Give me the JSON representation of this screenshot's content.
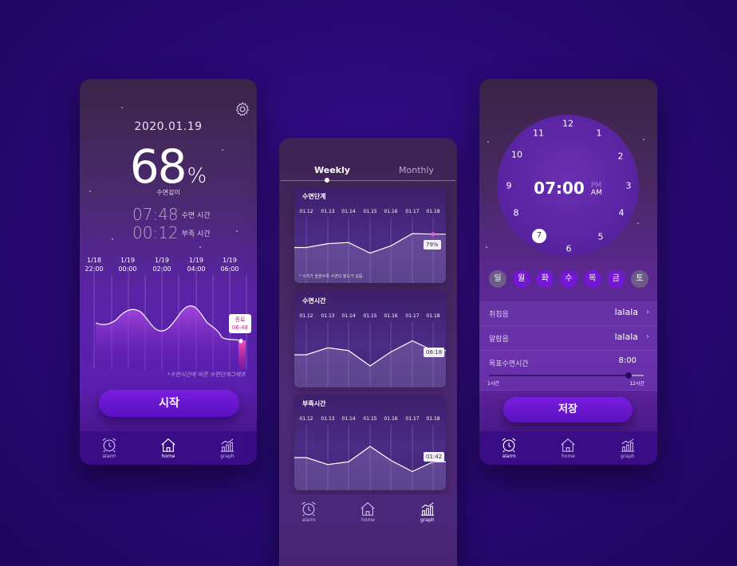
{
  "home": {
    "date": "2020.01.19",
    "percent": "68",
    "percent_unit": "%",
    "depth_label": "수면깊이",
    "sleep_time": "07:48",
    "sleep_time_label": "수면 시간",
    "short_time": "00:12",
    "short_time_label": "부족 시간",
    "timeline": [
      {
        "date": "1/18",
        "time": "22:00"
      },
      {
        "date": "1/19",
        "time": "00:00"
      },
      {
        "date": "1/19",
        "time": "02:00"
      },
      {
        "date": "1/19",
        "time": "04:00"
      },
      {
        "date": "1/19",
        "time": "06:00"
      }
    ],
    "end_tag_label": "종료",
    "end_tag_time": "06:48",
    "chart_note": "*수면시간에 따른 수면단계그래프",
    "start_button": "시작",
    "tabs": [
      {
        "label": "alarm"
      },
      {
        "label": "home"
      },
      {
        "label": "graph"
      }
    ]
  },
  "graph": {
    "segment_weekly": "Weekly",
    "segment_monthly": "Monthly",
    "dates": [
      "01.12",
      "01.13",
      "01.14",
      "01.15",
      "01.16",
      "01.17",
      "01.18"
    ],
    "cards": [
      {
        "title": "수면단계",
        "tag": "79%",
        "note": "* 수치가 높을수록 수면의 질도가 깊음"
      },
      {
        "title": "수면시간",
        "tag": "06:18"
      },
      {
        "title": "부족시간",
        "tag": "01:42"
      }
    ],
    "tabs": [
      {
        "label": "alarm"
      },
      {
        "label": "home"
      },
      {
        "label": "graph"
      }
    ]
  },
  "alarm": {
    "clock_numbers": [
      "12",
      "1",
      "2",
      "3",
      "4",
      "5",
      "6",
      "7",
      "8",
      "9",
      "10",
      "11"
    ],
    "selected_hour": "7",
    "time": "07:00",
    "pm": "PM",
    "am": "AM",
    "days": [
      "일",
      "월",
      "화",
      "수",
      "목",
      "금",
      "토"
    ],
    "bedtime_label": "취침음",
    "bedtime_value": "lalala",
    "alarm_label": "알람음",
    "alarm_value": "lalala",
    "goal_label": "목표수면시간",
    "goal_value": "8:00",
    "slider_min": "1시간",
    "slider_max": "12시간",
    "slider_fraction": 0.9,
    "save_button": "저장",
    "tabs": [
      {
        "label": "alarm"
      },
      {
        "label": "home"
      },
      {
        "label": "graph"
      }
    ]
  },
  "chart_data": [
    {
      "type": "area",
      "title": "",
      "x": [
        "01.12",
        "01.13",
        "01.14",
        "01.15",
        "01.16",
        "01.17",
        "01.18"
      ],
      "series": [
        {
          "values": [
            55,
            62,
            64,
            45,
            58,
            80,
            79
          ]
        }
      ],
      "ylim": [
        0,
        100
      ]
    },
    {
      "type": "line",
      "title": "",
      "x": [
        "01.12",
        "01.13",
        "01.14",
        "01.15",
        "01.16",
        "01.17",
        "01.18"
      ],
      "series": [
        {
          "values": [
            6.0,
            6.5,
            6.3,
            5.2,
            6.2,
            7.0,
            6.3
          ]
        }
      ]
    },
    {
      "type": "line",
      "title": "",
      "x": [
        "01.12",
        "01.13",
        "01.14",
        "01.15",
        "01.16",
        "01.17",
        "01.18"
      ],
      "series": [
        {
          "values": [
            2.0,
            1.5,
            1.7,
            2.8,
            1.8,
            1.0,
            1.7
          ]
        }
      ]
    }
  ]
}
